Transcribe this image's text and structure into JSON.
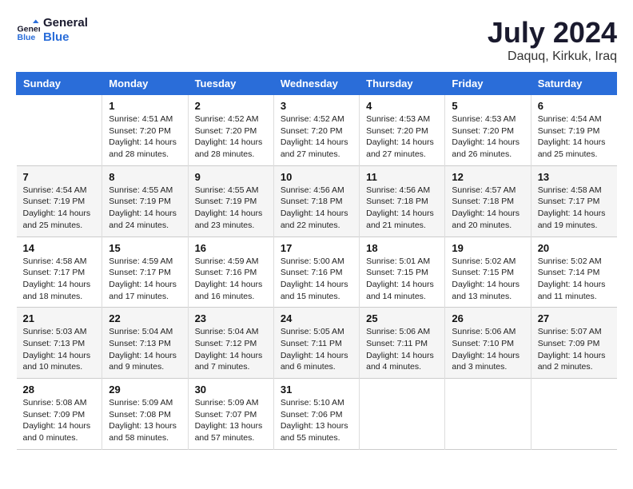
{
  "header": {
    "logo_line1": "General",
    "logo_line2": "Blue",
    "month": "July 2024",
    "location": "Daquq, Kirkuk, Iraq"
  },
  "columns": [
    "Sunday",
    "Monday",
    "Tuesday",
    "Wednesday",
    "Thursday",
    "Friday",
    "Saturday"
  ],
  "weeks": [
    [
      {
        "day": "",
        "info": ""
      },
      {
        "day": "1",
        "info": "Sunrise: 4:51 AM\nSunset: 7:20 PM\nDaylight: 14 hours\nand 28 minutes."
      },
      {
        "day": "2",
        "info": "Sunrise: 4:52 AM\nSunset: 7:20 PM\nDaylight: 14 hours\nand 28 minutes."
      },
      {
        "day": "3",
        "info": "Sunrise: 4:52 AM\nSunset: 7:20 PM\nDaylight: 14 hours\nand 27 minutes."
      },
      {
        "day": "4",
        "info": "Sunrise: 4:53 AM\nSunset: 7:20 PM\nDaylight: 14 hours\nand 27 minutes."
      },
      {
        "day": "5",
        "info": "Sunrise: 4:53 AM\nSunset: 7:20 PM\nDaylight: 14 hours\nand 26 minutes."
      },
      {
        "day": "6",
        "info": "Sunrise: 4:54 AM\nSunset: 7:19 PM\nDaylight: 14 hours\nand 25 minutes."
      }
    ],
    [
      {
        "day": "7",
        "info": "Sunrise: 4:54 AM\nSunset: 7:19 PM\nDaylight: 14 hours\nand 25 minutes."
      },
      {
        "day": "8",
        "info": "Sunrise: 4:55 AM\nSunset: 7:19 PM\nDaylight: 14 hours\nand 24 minutes."
      },
      {
        "day": "9",
        "info": "Sunrise: 4:55 AM\nSunset: 7:19 PM\nDaylight: 14 hours\nand 23 minutes."
      },
      {
        "day": "10",
        "info": "Sunrise: 4:56 AM\nSunset: 7:18 PM\nDaylight: 14 hours\nand 22 minutes."
      },
      {
        "day": "11",
        "info": "Sunrise: 4:56 AM\nSunset: 7:18 PM\nDaylight: 14 hours\nand 21 minutes."
      },
      {
        "day": "12",
        "info": "Sunrise: 4:57 AM\nSunset: 7:18 PM\nDaylight: 14 hours\nand 20 minutes."
      },
      {
        "day": "13",
        "info": "Sunrise: 4:58 AM\nSunset: 7:17 PM\nDaylight: 14 hours\nand 19 minutes."
      }
    ],
    [
      {
        "day": "14",
        "info": "Sunrise: 4:58 AM\nSunset: 7:17 PM\nDaylight: 14 hours\nand 18 minutes."
      },
      {
        "day": "15",
        "info": "Sunrise: 4:59 AM\nSunset: 7:17 PM\nDaylight: 14 hours\nand 17 minutes."
      },
      {
        "day": "16",
        "info": "Sunrise: 4:59 AM\nSunset: 7:16 PM\nDaylight: 14 hours\nand 16 minutes."
      },
      {
        "day": "17",
        "info": "Sunrise: 5:00 AM\nSunset: 7:16 PM\nDaylight: 14 hours\nand 15 minutes."
      },
      {
        "day": "18",
        "info": "Sunrise: 5:01 AM\nSunset: 7:15 PM\nDaylight: 14 hours\nand 14 minutes."
      },
      {
        "day": "19",
        "info": "Sunrise: 5:02 AM\nSunset: 7:15 PM\nDaylight: 14 hours\nand 13 minutes."
      },
      {
        "day": "20",
        "info": "Sunrise: 5:02 AM\nSunset: 7:14 PM\nDaylight: 14 hours\nand 11 minutes."
      }
    ],
    [
      {
        "day": "21",
        "info": "Sunrise: 5:03 AM\nSunset: 7:13 PM\nDaylight: 14 hours\nand 10 minutes."
      },
      {
        "day": "22",
        "info": "Sunrise: 5:04 AM\nSunset: 7:13 PM\nDaylight: 14 hours\nand 9 minutes."
      },
      {
        "day": "23",
        "info": "Sunrise: 5:04 AM\nSunset: 7:12 PM\nDaylight: 14 hours\nand 7 minutes."
      },
      {
        "day": "24",
        "info": "Sunrise: 5:05 AM\nSunset: 7:11 PM\nDaylight: 14 hours\nand 6 minutes."
      },
      {
        "day": "25",
        "info": "Sunrise: 5:06 AM\nSunset: 7:11 PM\nDaylight: 14 hours\nand 4 minutes."
      },
      {
        "day": "26",
        "info": "Sunrise: 5:06 AM\nSunset: 7:10 PM\nDaylight: 14 hours\nand 3 minutes."
      },
      {
        "day": "27",
        "info": "Sunrise: 5:07 AM\nSunset: 7:09 PM\nDaylight: 14 hours\nand 2 minutes."
      }
    ],
    [
      {
        "day": "28",
        "info": "Sunrise: 5:08 AM\nSunset: 7:09 PM\nDaylight: 14 hours\nand 0 minutes."
      },
      {
        "day": "29",
        "info": "Sunrise: 5:09 AM\nSunset: 7:08 PM\nDaylight: 13 hours\nand 58 minutes."
      },
      {
        "day": "30",
        "info": "Sunrise: 5:09 AM\nSunset: 7:07 PM\nDaylight: 13 hours\nand 57 minutes."
      },
      {
        "day": "31",
        "info": "Sunrise: 5:10 AM\nSunset: 7:06 PM\nDaylight: 13 hours\nand 55 minutes."
      },
      {
        "day": "",
        "info": ""
      },
      {
        "day": "",
        "info": ""
      },
      {
        "day": "",
        "info": ""
      }
    ]
  ]
}
